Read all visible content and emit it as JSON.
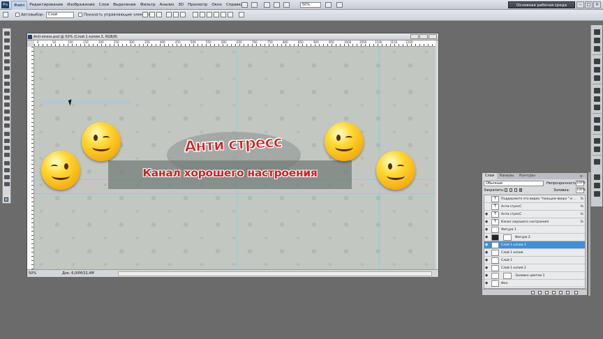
{
  "app": {
    "logo": "Ps"
  },
  "menu": [
    "Файл",
    "Редактирование",
    "Изображение",
    "Слои",
    "Выделение",
    "Фильтр",
    "Анализ",
    "3D",
    "Просмотр",
    "Окно",
    "Справка"
  ],
  "menubar": {
    "zoom": "50%",
    "workspace": "Основная рабочая среда"
  },
  "options": {
    "autoselect": "Автовыбор:",
    "autoselect_value": "Слой",
    "show_controls": "Показать управляющие элементы"
  },
  "document": {
    "title": "Anti-stress.psd @ 50% (Слой 1 копия 3, RGB/8)",
    "zoom": "50%",
    "doc_size": "Док: 6,00M/32,4M",
    "ruler_labels": [
      "0",
      "50",
      "100",
      "150",
      "200",
      "250",
      "300",
      "350",
      "400",
      "450",
      "500",
      "550",
      "600",
      "650",
      "700",
      "750",
      "800",
      "850",
      "900",
      "950",
      "1000",
      "1050",
      "1100",
      "1150",
      "1200"
    ],
    "title_text": "Анти стресс",
    "subtitle_text": "Канал хорошего настроения"
  },
  "layers_panel": {
    "tabs": [
      "Слои",
      "Каналы",
      "Контуры"
    ],
    "blend_mode": "Обычные",
    "opacity_label": "Непрозрачность:",
    "opacity_value": "100%",
    "lock_label": "Закрепить:",
    "fill_label": "Заливка:",
    "fill_value": "100%",
    "rows": [
      {
        "name": "Поддержите это видео \"пальцем вверх \" и ...",
        "thumb": "T",
        "fx": "fx",
        "visible": false,
        "selected": false
      },
      {
        "name": "Анти стресС",
        "thumb": "T",
        "fx": "fx",
        "visible": false,
        "selected": false
      },
      {
        "name": "Анти стресС",
        "thumb": "T",
        "fx": "fx",
        "visible": true,
        "selected": false
      },
      {
        "name": "Канал хорошего настроения",
        "thumb": "T",
        "fx": "fx",
        "visible": true,
        "selected": false
      },
      {
        "name": "Фигура 1",
        "thumb": "",
        "fx": "",
        "visible": true,
        "selected": false
      },
      {
        "name": "Фигура 2",
        "thumb": "",
        "fx": "",
        "visible": true,
        "selected": false
      },
      {
        "name": "Слой 1 копия 3",
        "thumb": "",
        "fx": "",
        "visible": true,
        "selected": true
      },
      {
        "name": "Слой 1 копия",
        "thumb": "",
        "fx": "",
        "visible": true,
        "selected": false
      },
      {
        "name": "Слой 1",
        "thumb": "",
        "fx": "",
        "visible": true,
        "selected": false
      },
      {
        "name": "Слой 1 копия 2",
        "thumb": "",
        "fx": "",
        "visible": true,
        "selected": false
      },
      {
        "name": "Заливка цветом 1",
        "thumb": "",
        "fx": "",
        "visible": true,
        "selected": false
      },
      {
        "name": "Фон",
        "thumb": "",
        "fx": "",
        "visible": true,
        "selected": false
      }
    ]
  },
  "icons": {
    "eye": "eye-icon",
    "fx": "fx-icon",
    "cursor": "arrow-cursor-icon"
  },
  "colors": {
    "accent": "#3e8fd8",
    "title_red": "#d71f1f",
    "canvas_bg": "#c2c7c2"
  }
}
